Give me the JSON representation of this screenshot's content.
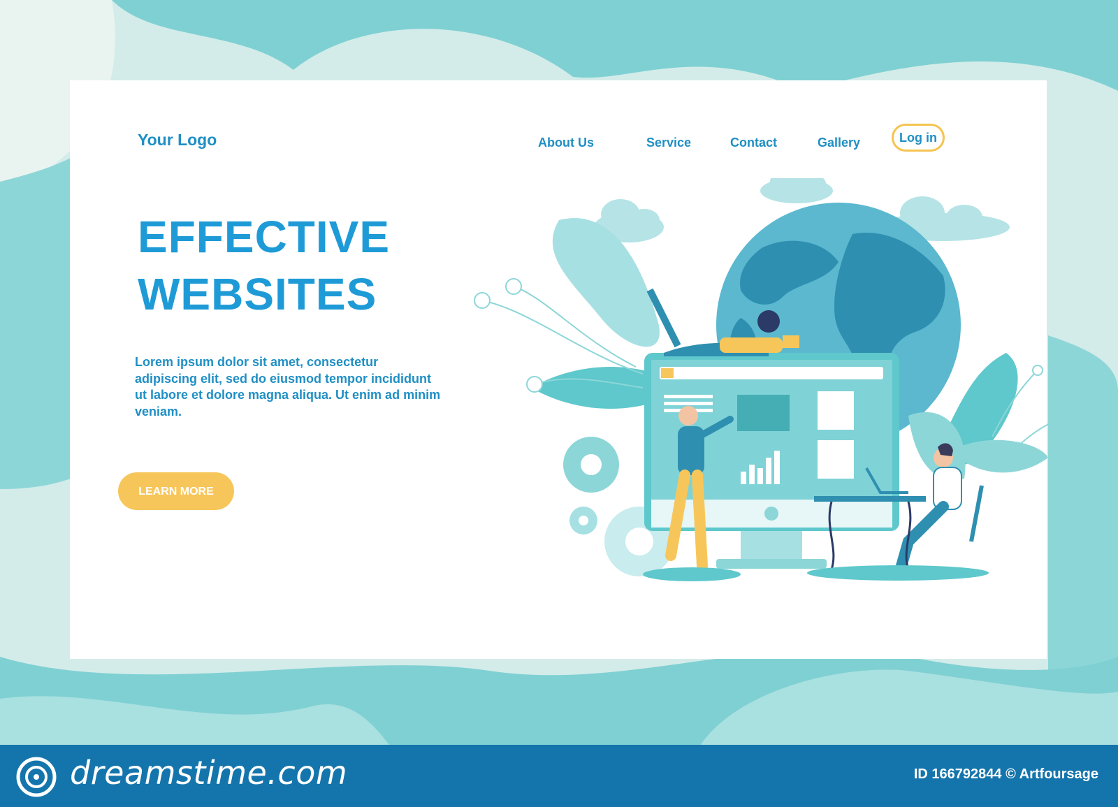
{
  "header": {
    "logo": "Your Logo",
    "nav": [
      "About Us",
      "Service",
      "Contact",
      "Gallery"
    ],
    "login": "Log in"
  },
  "hero": {
    "title_line1": "EFFECTIVE",
    "title_line2": "WEBSITES",
    "body": "Lorem ipsum dolor sit amet, consectetur adipiscing elit, sed do eiusmod tempor incididunt ut labore et dolore magna aliqua. Ut enim ad minim veniam.",
    "cta": "LEARN MORE"
  },
  "footer": {
    "brand": "dreamstime.com",
    "id_text": "ID 166792844 © Artfoursage"
  },
  "colors": {
    "accent": "#1e9bd7",
    "button": "#f7c65a",
    "footer": "#1475ac",
    "teal": "#5ec8cc"
  },
  "icons": {
    "gear": "gear-icon",
    "image": "image-icon",
    "globe": "globe-icon",
    "cloud": "cloud-icon"
  }
}
